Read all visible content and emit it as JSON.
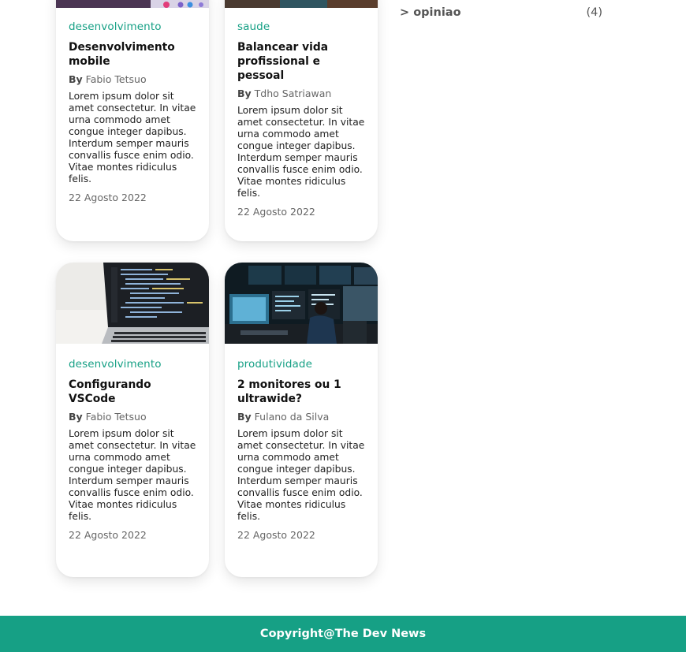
{
  "sidebar": {
    "categories": [
      {
        "label": "> opiniao",
        "count": "(4)"
      }
    ]
  },
  "posts": [
    {
      "category": "desenvolvimento",
      "title": "Desenvolvimento mobile",
      "by": "By",
      "author": "Fabio Tetsuo",
      "excerpt": "Lorem ipsum dolor sit amet consectetur. In vitae urna commodo amet congue integer dapibus. Interdum semper mauris convallis fusce enim odio. Vitae montes ridiculus felis.",
      "date": "22 Agosto 2022"
    },
    {
      "category": "saude",
      "title": "Balancear vida profissional e pessoal",
      "by": "By",
      "author": "Tdho Satriawan",
      "excerpt": "Lorem ipsum dolor sit amet consectetur. In vitae urna commodo amet congue integer dapibus. Interdum semper mauris convallis fusce enim odio. Vitae montes ridiculus felis.",
      "date": "22 Agosto 2022"
    },
    {
      "category": "desenvolvimento",
      "title": "Configurando VSCode",
      "by": "By",
      "author": "Fabio Tetsuo",
      "excerpt": "Lorem ipsum dolor sit amet consectetur. In vitae urna commodo amet congue integer dapibus. Interdum semper mauris convallis fusce enim odio. Vitae montes ridiculus felis.",
      "date": "22 Agosto 2022"
    },
    {
      "category": "produtividade",
      "title": "2 monitores ou 1 ultrawide?",
      "by": "By",
      "author": "Fulano da Silva",
      "excerpt": "Lorem ipsum dolor sit amet consectetur. In vitae urna commodo amet congue integer dapibus. Interdum semper mauris convallis fusce enim odio. Vitae montes ridiculus felis.",
      "date": "22 Agosto 2022"
    }
  ],
  "footer": {
    "copyright": "Copyright@The Dev News"
  },
  "colors": {
    "accent": "#16a085",
    "title": "#111111",
    "muted": "#666666"
  }
}
